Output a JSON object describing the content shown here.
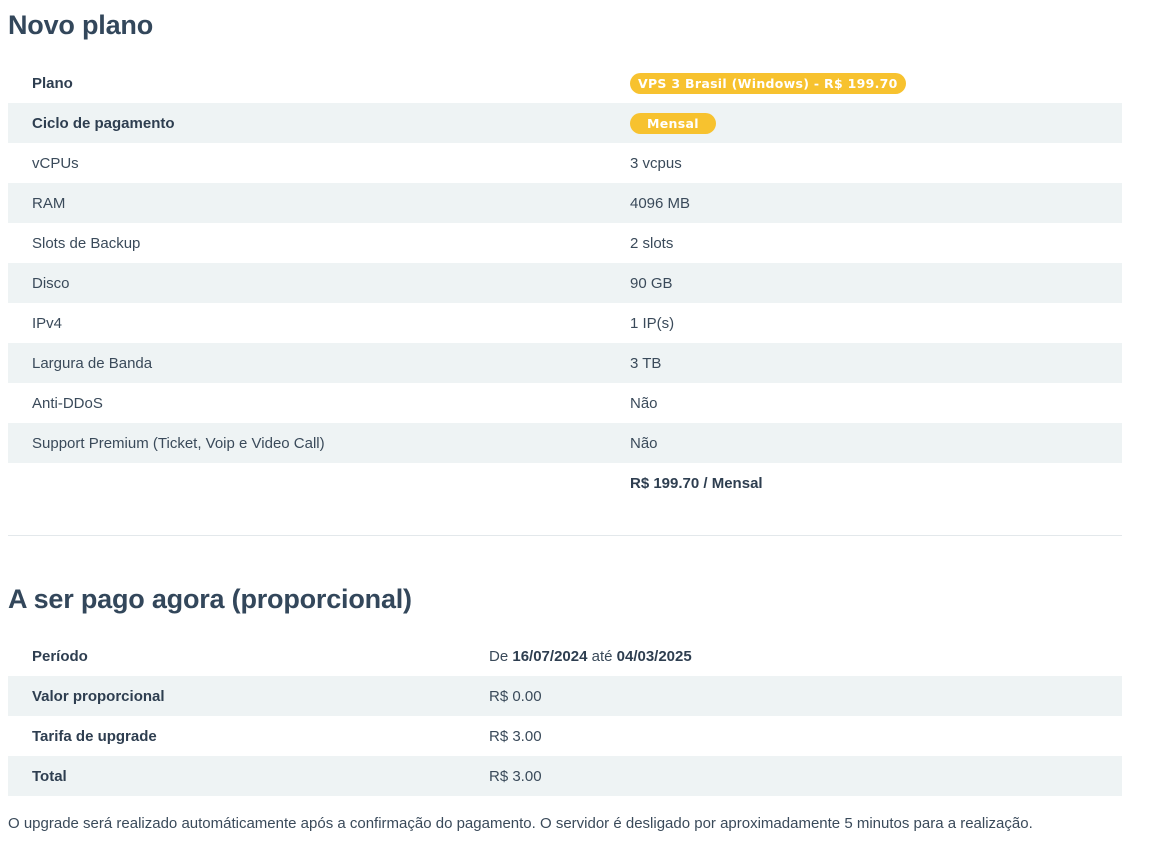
{
  "section1": {
    "title": "Novo plano",
    "plan": {
      "label": "Plano",
      "value": "VPS 3 Brasil (Windows) - R$ 199.70"
    },
    "cycle": {
      "label": "Ciclo de pagamento",
      "value": "Mensal"
    },
    "specs": [
      {
        "label": "vCPUs",
        "value": "3 vcpus"
      },
      {
        "label": "RAM",
        "value": "4096 MB"
      },
      {
        "label": "Slots de Backup",
        "value": "2 slots"
      },
      {
        "label": "Disco",
        "value": "90 GB"
      },
      {
        "label": "IPv4",
        "value": "1 IP(s)"
      },
      {
        "label": "Largura de Banda",
        "value": "3 TB"
      },
      {
        "label": "Anti-DDoS",
        "value": "Não"
      },
      {
        "label": "Support Premium (Ticket, Voip e Video Call)",
        "value": "Não"
      }
    ],
    "total": "R$ 199.70 / Mensal"
  },
  "section2": {
    "title": "A ser pago agora (proporcional)",
    "period": {
      "label": "Período",
      "prefix": "De",
      "start": "16/07/2024",
      "mid": "até",
      "end": "04/03/2025"
    },
    "rows": [
      {
        "label": "Valor proporcional",
        "value": "R$ 0.00"
      },
      {
        "label": "Tarifa de upgrade",
        "value": "R$ 3.00"
      },
      {
        "label": "Total",
        "value": "R$ 3.00"
      }
    ]
  },
  "note": "O upgrade será realizado automáticamente após a confirmação do pagamento. O servidor é desligado por aproximadamente 5 minutos para a realização.",
  "colors": {
    "badge": "#f7c22f",
    "row_alt": "#eef3f4",
    "title": "#33475b"
  }
}
